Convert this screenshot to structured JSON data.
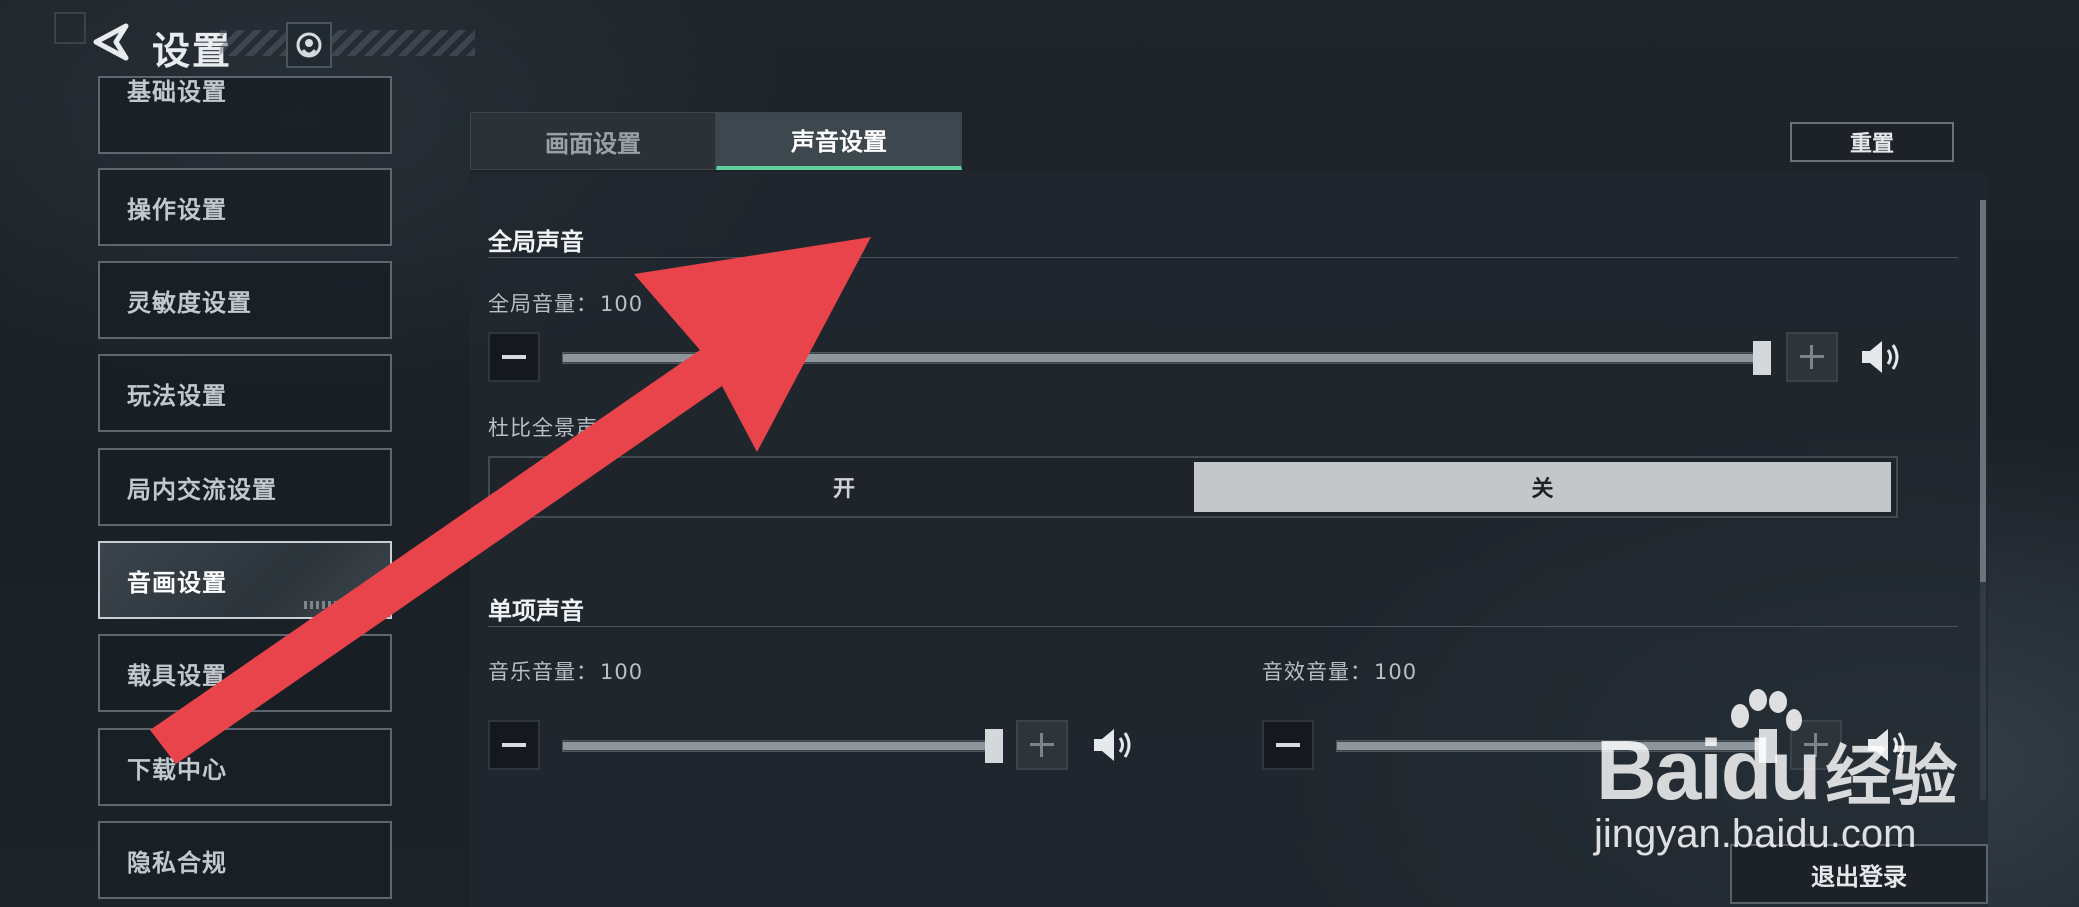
{
  "header": {
    "title": "设置"
  },
  "sidebar": {
    "items": [
      {
        "label": "基础设置"
      },
      {
        "label": "操作设置"
      },
      {
        "label": "灵敏度设置"
      },
      {
        "label": "玩法设置"
      },
      {
        "label": "局内交流设置"
      },
      {
        "label": "音画设置"
      },
      {
        "label": "载具设置"
      },
      {
        "label": "下载中心"
      },
      {
        "label": "隐私合规"
      }
    ],
    "active_index": 5
  },
  "tabs": [
    {
      "label": "画面设置"
    },
    {
      "label": "声音设置"
    }
  ],
  "active_tab": 1,
  "reset_label": "重置",
  "global_sound": {
    "title": "全局声音",
    "volume_label": "全局音量：",
    "volume_value": "100",
    "volume_level": 1.0,
    "dolby_label": "杜比全景声",
    "dolby_on_label": "开",
    "dolby_off_label": "关",
    "dolby_selected": "关"
  },
  "individual_sound": {
    "title": "单项声音",
    "music_label": "音乐音量：",
    "music_value": "100",
    "music_level": 1.0,
    "sfx_label": "音效音量：",
    "sfx_value": "100",
    "sfx_level": 1.0
  },
  "logout_label": "退出登录",
  "watermark": {
    "logo_text": "Bai",
    "logo_text_2": "du",
    "logo_cn": "经验",
    "url": "jingyan.baidu.com"
  },
  "colors": {
    "accent": "#5fcf9b",
    "annotation_arrow": "#e9444b",
    "toggle_selected_bg": "#c3c7ca"
  }
}
